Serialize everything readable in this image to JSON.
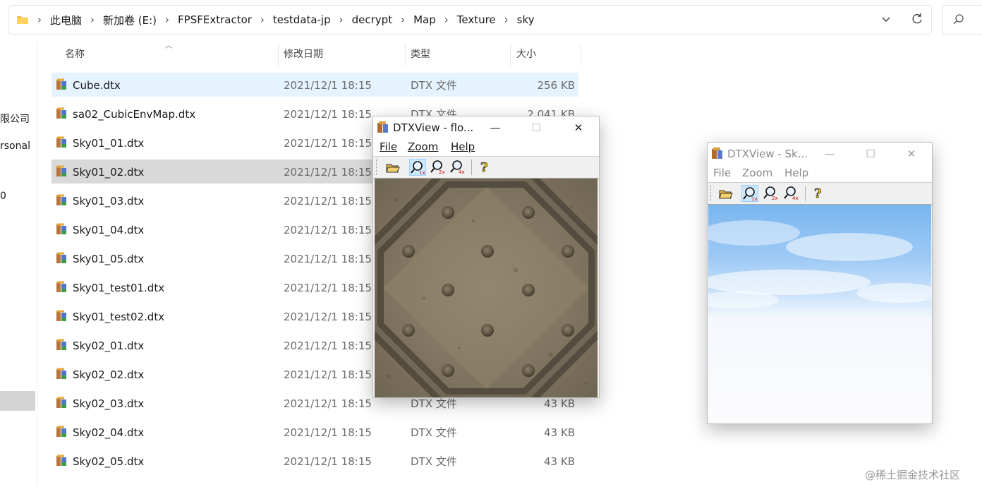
{
  "address_bar": {
    "breadcrumbs": [
      "此电脑",
      "新加卷 (E:)",
      "FPSFExtractor",
      "testdata-jp",
      "decrypt",
      "Map",
      "Texture",
      "sky"
    ]
  },
  "nav_fragments": [
    "限公司",
    "rsonal",
    "0"
  ],
  "file_list": {
    "columns": {
      "name": "名称",
      "date": "修改日期",
      "type": "类型",
      "size": "大小"
    },
    "rows": [
      {
        "name": "Cube.dtx",
        "date": "2021/12/1 18:15",
        "type": "DTX 文件",
        "size": "256 KB",
        "state": "hover"
      },
      {
        "name": "sa02_CubicEnvMap.dtx",
        "date": "2021/12/1 18:15",
        "type": "DTX 文件",
        "size": "2,041 KB",
        "state": ""
      },
      {
        "name": "Sky01_01.dtx",
        "date": "2021/12/1 18:15",
        "type": "",
        "size": "",
        "state": ""
      },
      {
        "name": "Sky01_02.dtx",
        "date": "2021/12/1 18:15",
        "type": "",
        "size": "",
        "state": "selected"
      },
      {
        "name": "Sky01_03.dtx",
        "date": "2021/12/1 18:15",
        "type": "",
        "size": "",
        "state": ""
      },
      {
        "name": "Sky01_04.dtx",
        "date": "2021/12/1 18:15",
        "type": "",
        "size": "",
        "state": ""
      },
      {
        "name": "Sky01_05.dtx",
        "date": "2021/12/1 18:15",
        "type": "",
        "size": "",
        "state": ""
      },
      {
        "name": "Sky01_test01.dtx",
        "date": "2021/12/1 18:15",
        "type": "",
        "size": "",
        "state": ""
      },
      {
        "name": "Sky01_test02.dtx",
        "date": "2021/12/1 18:15",
        "type": "",
        "size": "",
        "state": ""
      },
      {
        "name": "Sky02_01.dtx",
        "date": "2021/12/1 18:15",
        "type": "",
        "size": "",
        "state": ""
      },
      {
        "name": "Sky02_02.dtx",
        "date": "2021/12/1 18:15",
        "type": "",
        "size": "",
        "state": ""
      },
      {
        "name": "Sky02_03.dtx",
        "date": "2021/12/1 18:15",
        "type": "DTX 文件",
        "size": "43 KB",
        "state": ""
      },
      {
        "name": "Sky02_04.dtx",
        "date": "2021/12/1 18:15",
        "type": "DTX 文件",
        "size": "43 KB",
        "state": ""
      },
      {
        "name": "Sky02_05.dtx",
        "date": "2021/12/1 18:15",
        "type": "DTX 文件",
        "size": "43 KB",
        "state": ""
      }
    ]
  },
  "dtxview_front": {
    "title": "DTXView - flo...",
    "menu": {
      "file": "File",
      "zoom": "Zoom",
      "help": "Help"
    },
    "image": "metal-floor-texture"
  },
  "dtxview_back": {
    "title": "DTXView - Sk...",
    "menu": {
      "file": "File",
      "zoom": "Zoom",
      "help": "Help"
    },
    "image": "sky-texture"
  },
  "watermark": "@稀土掘金技术社区",
  "colors": {
    "hover_row": "#e5f3ff",
    "selected_row": "#d9d9d9",
    "toolbar_active": "#cce8ff"
  }
}
